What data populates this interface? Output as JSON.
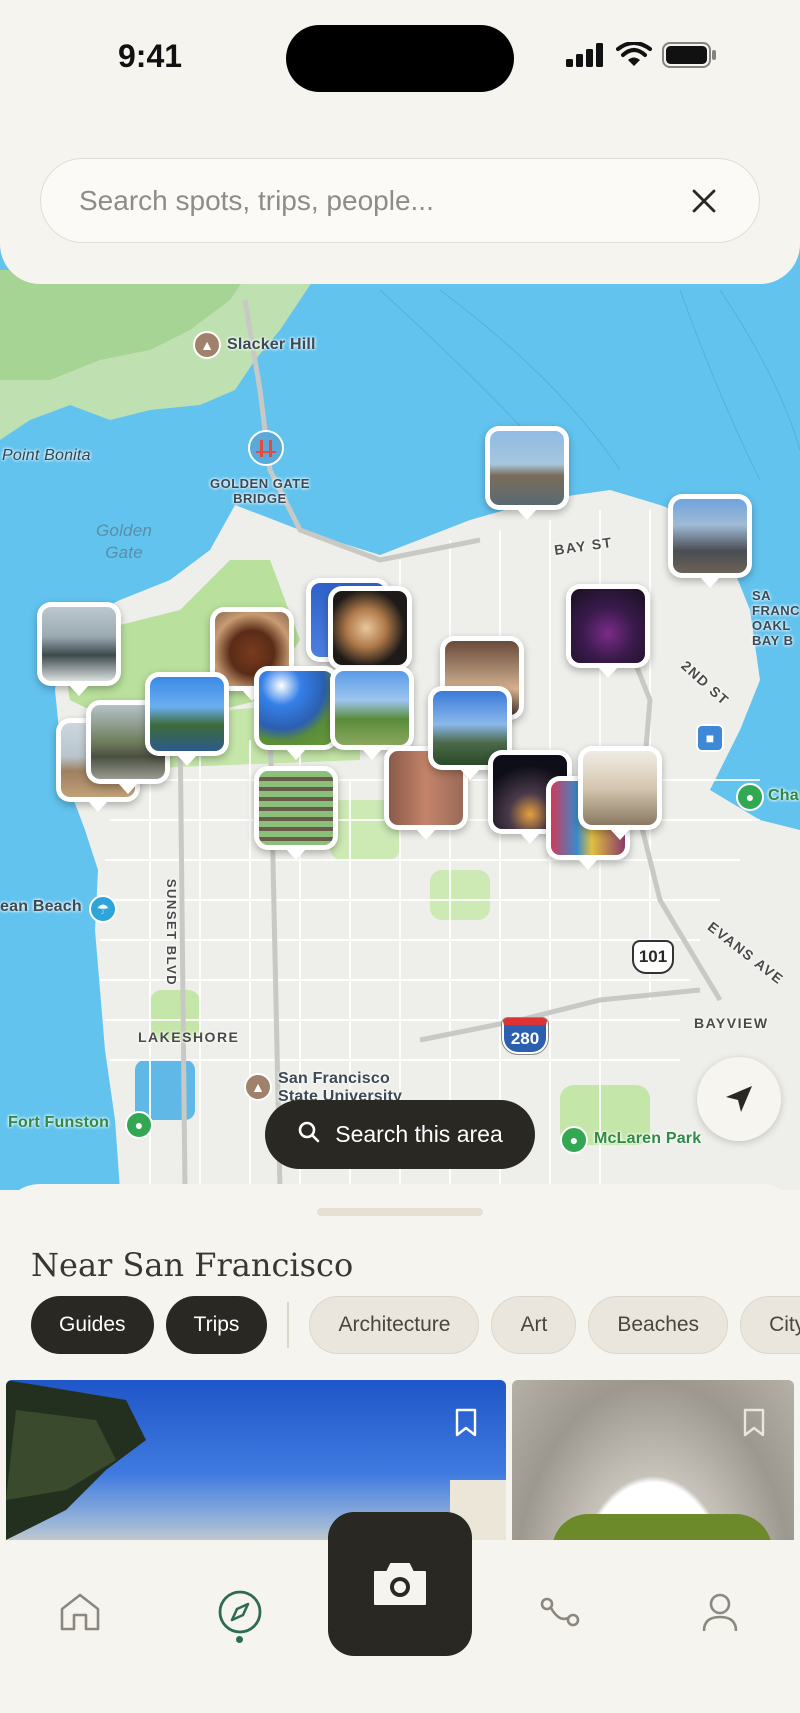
{
  "status_bar": {
    "time": "9:41"
  },
  "search": {
    "placeholder": "Search spots, trips, people..."
  },
  "map": {
    "labels": {
      "slacker_hill": "Slacker Hill",
      "point_bonita": "Point Bonita",
      "golden_gate_bridge": "GOLDEN GATE\nBRIDGE",
      "golden_gate_water": "Golden\nGate",
      "bay_st": "BAY ST",
      "second_st": "2ND ST",
      "sf_oakland_bay": "SA\nFRANC\nOAKL\nBAY B",
      "chase": "Cha",
      "ocean_beach": "ean Beach",
      "sunset_blvd": "SUNSET BLVD",
      "evans_ave": "EVANS AVE",
      "lakeshore": "LAKESHORE",
      "bayview": "BAYVIEW",
      "sf_state": "San Francisco\nState University",
      "fort_funston": "Fort Funston",
      "mclaren_park": "McLaren Park",
      "hwy_101": "101",
      "hwy_280": "280"
    },
    "search_area_label": "Search this area"
  },
  "sheet": {
    "title": "Near San Francisco",
    "chips": [
      {
        "label": "Guides",
        "active": true
      },
      {
        "label": "Trips",
        "active": true
      },
      {
        "label": "Architecture",
        "active": false
      },
      {
        "label": "Art",
        "active": false
      },
      {
        "label": "Beaches",
        "active": false
      },
      {
        "label": "City",
        "active": false
      }
    ]
  },
  "tabs": {
    "items": [
      "home-icon",
      "compass-icon",
      "camera-icon",
      "route-icon",
      "profile-icon"
    ],
    "active": "compass-icon"
  },
  "colors": {
    "accent_dark": "#2a2823",
    "active_tab": "#2f6b54",
    "water": "#62c3ef",
    "background": "#f6f4ef"
  }
}
